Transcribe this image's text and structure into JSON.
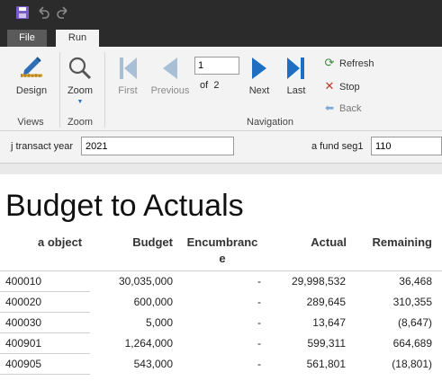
{
  "toolbar_icons": [
    "save-icon",
    "undo-icon",
    "redo-icon"
  ],
  "tabs": {
    "file": "File",
    "run": "Run"
  },
  "ribbon": {
    "design": "Design",
    "zoom": "Zoom",
    "first": "First",
    "previous": "Previous",
    "page_value": "1",
    "of_text": "of",
    "total_pages": "2",
    "next": "Next",
    "last": "Last",
    "refresh": "Refresh",
    "stop": "Stop",
    "back": "Back",
    "group_views": "Views",
    "group_zoom": "Zoom",
    "group_navigation": "Navigation"
  },
  "params": {
    "year_label": "j transact year",
    "year_value": "2021",
    "fund_label": "a fund seg1",
    "fund_value": "110"
  },
  "report": {
    "title": "Budget to Actuals",
    "columns": {
      "object": "a object",
      "budget": "Budget",
      "encumbrance_1": "Encumbranc",
      "encumbrance_2": "e",
      "actual": "Actual",
      "remaining": "Remaining"
    },
    "rows": [
      {
        "object": "400010",
        "budget": "30,035,000",
        "encumbrance": "-",
        "actual": "29,998,532",
        "remaining": "36,468"
      },
      {
        "object": "400020",
        "budget": "600,000",
        "encumbrance": "-",
        "actual": "289,645",
        "remaining": "310,355"
      },
      {
        "object": "400030",
        "budget": "5,000",
        "encumbrance": "-",
        "actual": "13,647",
        "remaining": "(8,647)"
      },
      {
        "object": "400901",
        "budget": "1,264,000",
        "encumbrance": "-",
        "actual": "599,311",
        "remaining": "664,689"
      },
      {
        "object": "400905",
        "budget": "543,000",
        "encumbrance": "-",
        "actual": "561,801",
        "remaining": "(18,801)"
      }
    ]
  },
  "colors": {
    "dark_chrome": "#2b2b2b",
    "ribbon_bg": "#f3f3f3",
    "nav_blue": "#1e6fc2",
    "nav_disabled": "#a9bfd6",
    "stop_red": "#c0392b",
    "refresh_green": "#3a8a3a"
  }
}
